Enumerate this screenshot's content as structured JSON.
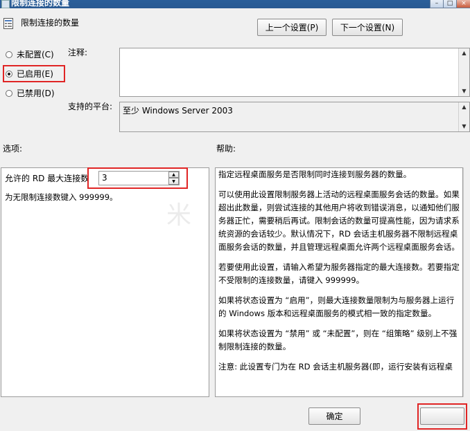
{
  "window": {
    "title": "限制连接的数量"
  },
  "header": {
    "policy_title": "限制连接的数量",
    "prev_button": "上一个设置(P)",
    "next_button": "下一个设置(N)"
  },
  "state_options": [
    {
      "label": "未配置(C)",
      "checked": false
    },
    {
      "label": "已启用(E)",
      "checked": true
    },
    {
      "label": "已禁用(D)",
      "checked": false
    }
  ],
  "comment": {
    "label": "注释:",
    "value": ""
  },
  "platform": {
    "label": "支持的平台:",
    "value": "至少 Windows Server 2003"
  },
  "options": {
    "heading": "选项:",
    "max_connections_label": "允许的 RD 最大连接数",
    "max_connections_value": "3",
    "hint": "为无限制连接数键入 999999。"
  },
  "help": {
    "heading": "帮助:",
    "paragraphs": [
      "指定远程桌面服务是否限制同时连接到服务器的数量。",
      "可以使用此设置限制服务器上活动的远程桌面服务会话的数量。如果超出此数量，则尝试连接的其他用户将收到错误消息，以通知他们服务器正忙，需要稍后再试。限制会话的数量可提高性能，因为请求系统资源的会话较少。默认情况下，RD 会话主机服务器不限制远程桌面服务会话的数量，并且管理远程桌面允许两个远程桌面服务会话。",
      "若要使用此设置，请输入希望为服务器指定的最大连接数。若要指定不受限制的连接数量，请键入 999999。",
      "如果将状态设置为 “启用”，则最大连接数量限制为与服务器上运行的 Windows 版本和远程桌面服务的模式相一致的指定数量。",
      "如果将状态设置为 “禁用” 或 “未配置”，则在 “组策略” 级别上不强制限制连接的数量。",
      "注意: 此设置专门为在 RD 会话主机服务器(即，运行安装有远程桌"
    ]
  },
  "footer": {
    "ok_button": "确定"
  },
  "watermark": "米",
  "colors": {
    "highlight_box": "#e02424",
    "titlebar": "#2b5f9a"
  }
}
